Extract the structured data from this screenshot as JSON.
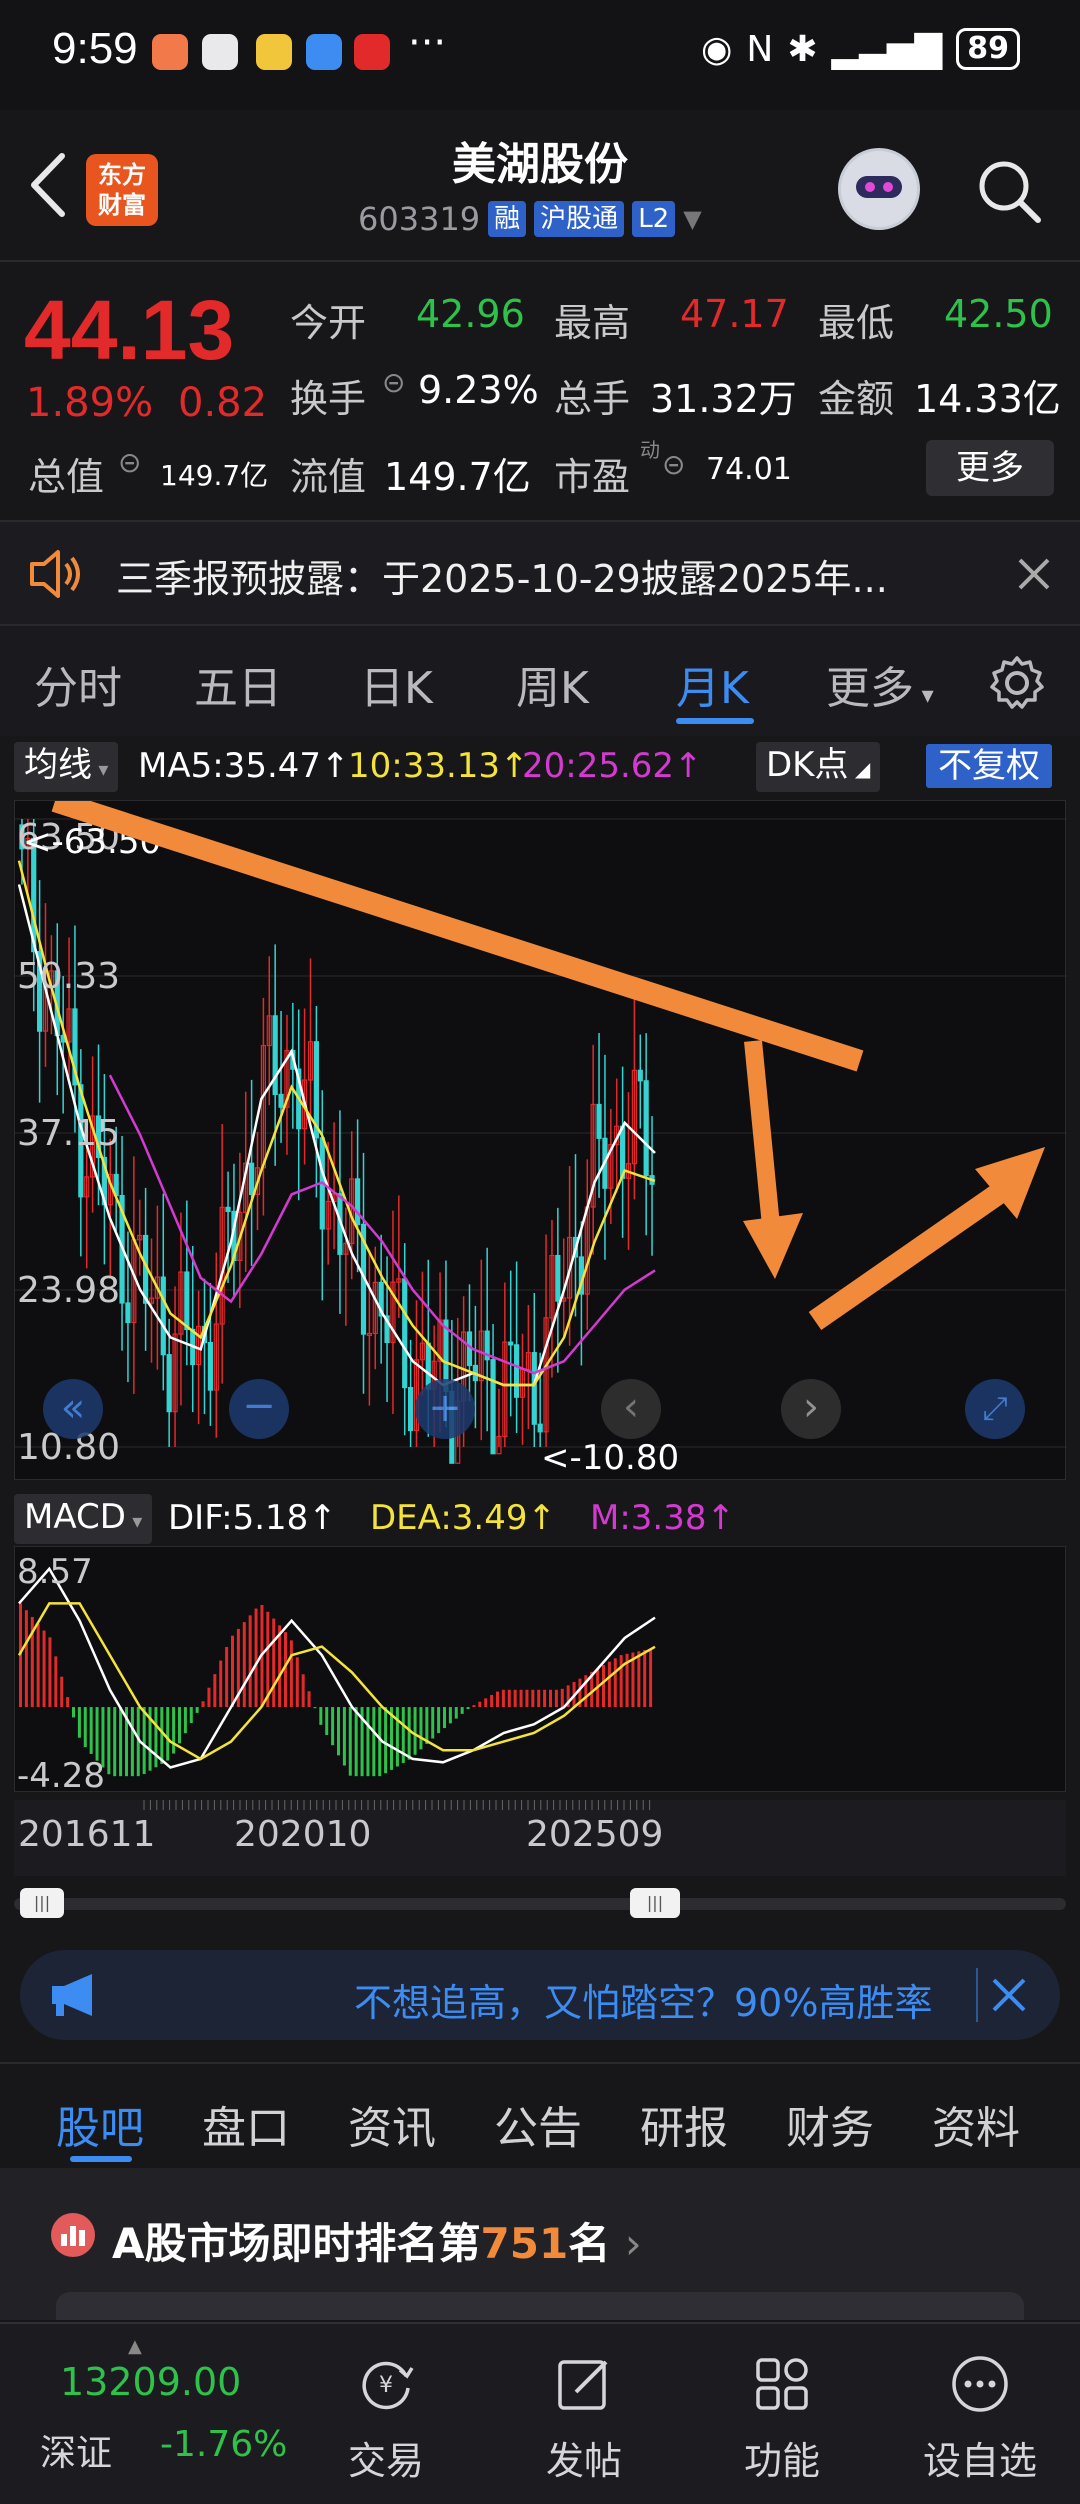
{
  "status_bar": {
    "time": "9:59",
    "dots": "···",
    "battery": "89"
  },
  "header": {
    "title": "美湖股份",
    "code": "603319",
    "tags": [
      "融",
      "沪股通",
      "L2"
    ],
    "logo_line1": "东方",
    "logo_line2": "财富"
  },
  "quote": {
    "price": "44.13",
    "change_pct": "1.89%",
    "change": "0.82",
    "open_label": "今开",
    "open": "42.96",
    "high_label": "最高",
    "high": "47.17",
    "low_label": "最低",
    "low": "42.50",
    "turnover_label": "换手",
    "turnover": "9.23%",
    "volume_label": "总手",
    "volume": "31.32万",
    "amount_label": "金额",
    "amount": "14.33亿",
    "mktcap_label": "总值",
    "mktcap": "149.7亿",
    "float_label": "流值",
    "float": "149.7亿",
    "pe_label": "市盈",
    "pe_sup": "动",
    "pe": "74.01",
    "more": "更多"
  },
  "notice": {
    "text": "三季报预披露：于2025-10-29披露2025年..."
  },
  "period_tabs": [
    "分时",
    "五日",
    "日K",
    "周K",
    "月K",
    "更多"
  ],
  "chart_bar": {
    "ma_btn": "均线",
    "ma5": "MA5:35.47↑",
    "ma10": "10:33.13↑",
    "ma20": "20:25.62↑",
    "dk": "DK点",
    "fq": "不复权"
  },
  "kline": {
    "y_labels": [
      "63.50",
      "50.33",
      "37.15",
      "23.98",
      "10.80"
    ],
    "high_mark": "<-63.50",
    "low_mark": "<-10.80"
  },
  "macd": {
    "btn": "MACD",
    "dif": "DIF:5.18↑",
    "dea": "DEA:3.49↑",
    "m": "M:3.38↑",
    "y_top": "8.57",
    "y_bot": "-4.28"
  },
  "dates": [
    "201611",
    "202010",
    "202509"
  ],
  "ad": {
    "text": "不想追高，又怕踏空？90%高胜率"
  },
  "content_tabs": [
    "股吧",
    "盘口",
    "资讯",
    "公告",
    "研报",
    "财务",
    "资料"
  ],
  "rank": {
    "prefix": "A股市场即时排名第",
    "num": "751",
    "suffix": "名"
  },
  "bottom_nav": {
    "index_value": "13209.00",
    "index_name": "深证",
    "index_change": "-1.76%",
    "items": [
      "交易",
      "发帖",
      "功能",
      "设自选"
    ]
  },
  "colors": {
    "up": "#e22a2a",
    "down": "#2fc24b",
    "accent": "#3c8cf2",
    "arrow": "#f28a3b"
  },
  "chart_data": {
    "type": "line",
    "title": "",
    "ylim": [
      10.8,
      63.5
    ],
    "x_ticks": [
      "201611",
      "202010",
      "202509"
    ],
    "series": [
      {
        "name": "MA5",
        "values": [
          58,
          48,
          38,
          30,
          24,
          20,
          19,
          28,
          40,
          44,
          34,
          27,
          22,
          18,
          16,
          17,
          16,
          16,
          24,
          33,
          38,
          35.47
        ]
      },
      {
        "name": "10",
        "values": [
          60,
          50,
          41,
          33,
          27,
          22,
          20,
          26,
          34,
          41,
          37,
          30,
          25,
          21,
          18,
          17,
          16,
          16,
          20,
          28,
          34,
          33.13
        ]
      },
      {
        "name": "20",
        "values": [
          null,
          null,
          null,
          42,
          37,
          31,
          25,
          23,
          27,
          32,
          33,
          31,
          28,
          24,
          21,
          19,
          18,
          17,
          18,
          21,
          24,
          25.62
        ]
      }
    ],
    "macd": {
      "ylim": [
        -4.28,
        8.57
      ],
      "dif": [
        6,
        8,
        5,
        1,
        -2,
        -3.5,
        -3,
        0,
        3,
        5,
        3,
        0,
        -2,
        -3,
        -3.2,
        -2.5,
        -1.5,
        -1,
        0,
        2,
        4,
        5.18
      ],
      "dea": [
        3,
        6,
        6,
        3,
        0,
        -2,
        -3,
        -2,
        0,
        3,
        3.5,
        2,
        0,
        -1.5,
        -2.5,
        -2.5,
        -2,
        -1.5,
        -0.5,
        1,
        2.5,
        3.49
      ]
    }
  }
}
